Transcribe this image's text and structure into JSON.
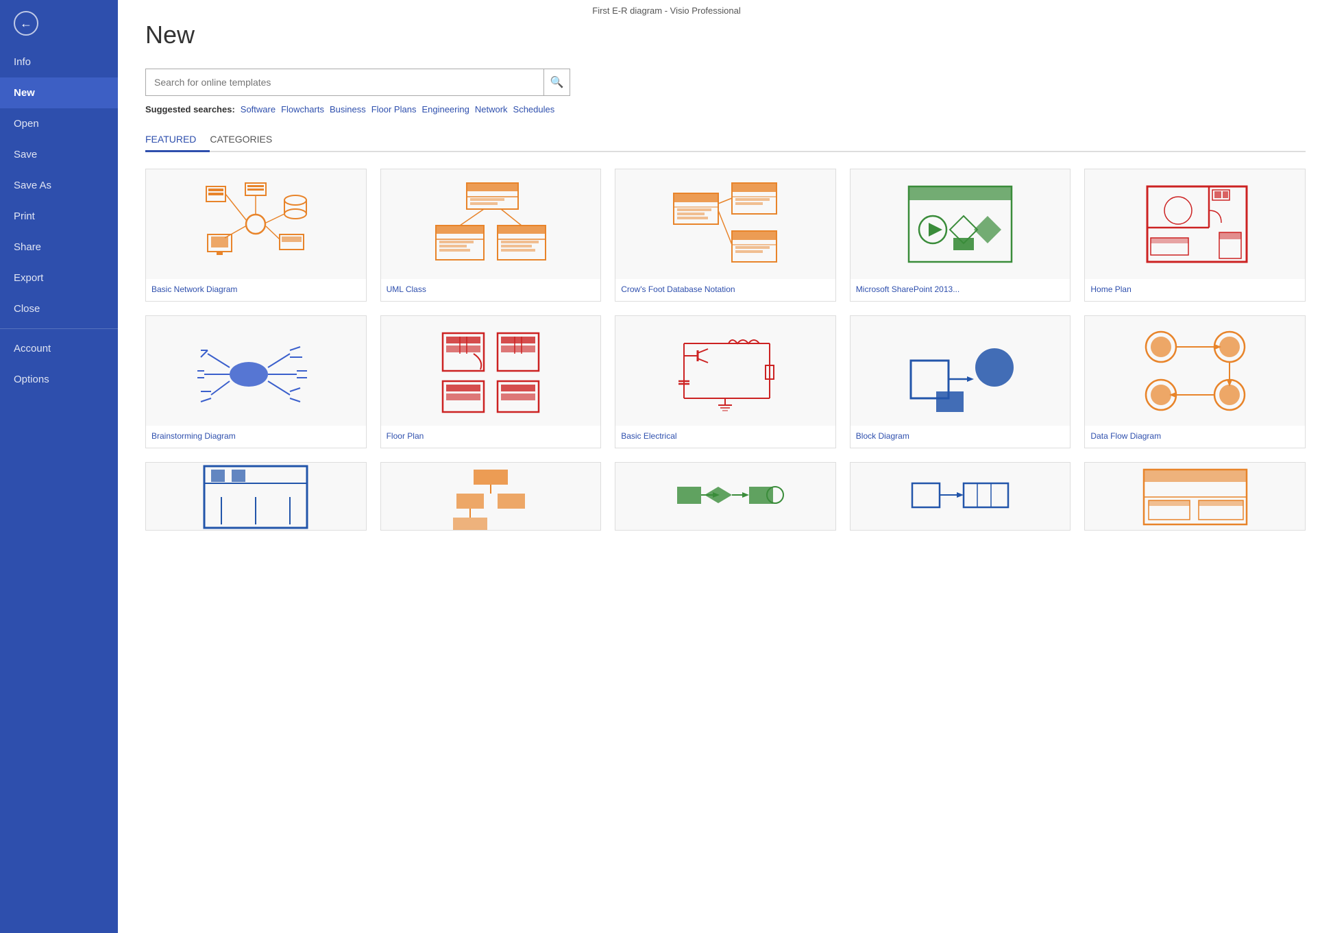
{
  "window": {
    "title": "First E-R diagram - Visio Professional"
  },
  "sidebar": {
    "items": [
      {
        "id": "info",
        "label": "Info",
        "active": false
      },
      {
        "id": "new",
        "label": "New",
        "active": true
      },
      {
        "id": "open",
        "label": "Open",
        "active": false
      },
      {
        "id": "save",
        "label": "Save",
        "active": false
      },
      {
        "id": "save-as",
        "label": "Save As",
        "active": false
      },
      {
        "id": "print",
        "label": "Print",
        "active": false
      },
      {
        "id": "share",
        "label": "Share",
        "active": false
      },
      {
        "id": "export",
        "label": "Export",
        "active": false
      },
      {
        "id": "close",
        "label": "Close",
        "active": false
      },
      {
        "id": "account",
        "label": "Account",
        "active": false
      },
      {
        "id": "options",
        "label": "Options",
        "active": false
      }
    ],
    "divider_after": [
      "close"
    ]
  },
  "main": {
    "page_title": "New",
    "search": {
      "placeholder": "Search for online templates"
    },
    "suggested_label": "Suggested searches:",
    "suggested_items": [
      "Software",
      "Flowcharts",
      "Business",
      "Floor Plans",
      "Engineering",
      "Network",
      "Schedules"
    ],
    "tabs": [
      {
        "id": "featured",
        "label": "FEATURED",
        "active": true
      },
      {
        "id": "categories",
        "label": "CATEGORIES",
        "active": false
      }
    ],
    "templates_row1": [
      {
        "id": "basic-network",
        "name": "Basic Network Diagram"
      },
      {
        "id": "uml-class",
        "name": "UML Class"
      },
      {
        "id": "crows-foot",
        "name": "Crow's Foot Database Notation"
      },
      {
        "id": "sharepoint",
        "name": "Microsoft SharePoint 2013..."
      },
      {
        "id": "home-plan",
        "name": "Home Plan"
      }
    ],
    "templates_row2": [
      {
        "id": "brainstorming",
        "name": "Brainstorming Diagram"
      },
      {
        "id": "floor-plan",
        "name": "Floor Plan"
      },
      {
        "id": "basic-electrical",
        "name": "Basic Electrical"
      },
      {
        "id": "block-diagram",
        "name": "Block Diagram"
      },
      {
        "id": "data-flow",
        "name": "Data Flow Diagram"
      }
    ],
    "templates_row3": [
      {
        "id": "template-r3-1",
        "name": ""
      },
      {
        "id": "template-r3-2",
        "name": ""
      },
      {
        "id": "template-r3-3",
        "name": ""
      },
      {
        "id": "template-r3-4",
        "name": ""
      },
      {
        "id": "template-r3-5",
        "name": ""
      }
    ]
  }
}
